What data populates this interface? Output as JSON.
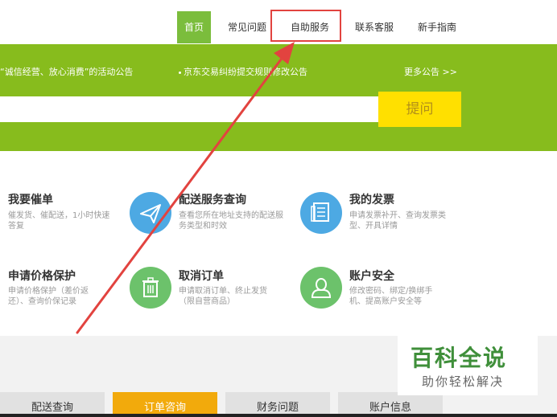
{
  "nav": {
    "items": [
      {
        "label": "首页"
      },
      {
        "label": "常见问题"
      },
      {
        "label": "自助服务"
      },
      {
        "label": "联系客服"
      },
      {
        "label": "新手指南"
      }
    ]
  },
  "banner": {
    "notice_1": "“诚信经营、放心消费”的活动公告",
    "notice_2": "京东交易纠纷提交规则修改公告",
    "more_link": "更多公告 >>",
    "search_placeholder": "",
    "ask_label": "提问"
  },
  "services": [
    {
      "title": "我要催单",
      "desc": "催发货、催配送，1小时快速答复",
      "color": "#4da9e3",
      "icon": "bell-icon"
    },
    {
      "title": "配送服务查询",
      "desc": "查看您所在地址支持的配送服务类型和时效",
      "color": "#4da9e3",
      "icon": "paper-plane-icon"
    },
    {
      "title": "我的发票",
      "desc": "申请发票补开、查询发票类型、开具详情",
      "color": "#4da9e3",
      "icon": "invoice-icon"
    },
    {
      "title": "申请价格保护",
      "desc": "申请价格保护（差价返还）、查询价保记录",
      "color": "#5fb95f",
      "icon": "price-tag-icon"
    },
    {
      "title": "取消订单",
      "desc": "申请取消订单、终止发货（限自营商品）",
      "color": "#6cc26b",
      "icon": "trash-icon"
    },
    {
      "title": "账户安全",
      "desc": "修改密码、绑定/换绑手机、提高账户安全等",
      "color": "#6cc26b",
      "icon": "user-icon"
    }
  ],
  "bottom_tabs": [
    {
      "label": "配送查询"
    },
    {
      "label": "订单咨询"
    },
    {
      "label": "财务问题"
    },
    {
      "label": "账户信息"
    }
  ],
  "watermark": {
    "title": "百科全说",
    "subtitle": "助你轻松解决"
  },
  "colors": {
    "banner_green": "#87bc1d",
    "nav_active": "#7bbd3c",
    "ask_yellow": "#ffe000",
    "highlight_red": "#e2433f",
    "tab_active": "#f2aa0c"
  }
}
